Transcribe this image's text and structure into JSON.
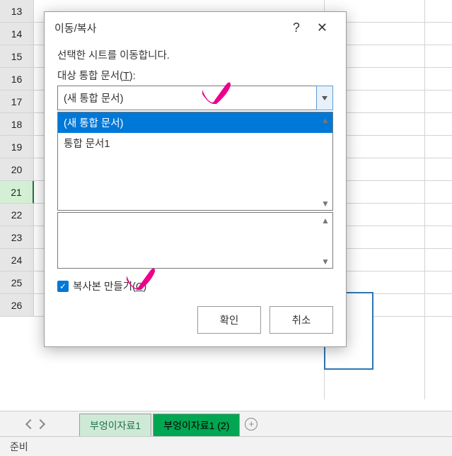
{
  "rows": [
    "13",
    "14",
    "15",
    "16",
    "17",
    "18",
    "19",
    "20",
    "21",
    "22",
    "23",
    "24",
    "25",
    "26"
  ],
  "selected_row": "21",
  "sheet_tabs": {
    "items": [
      {
        "label": "부엉이자료1",
        "variant": "light"
      },
      {
        "label": "부엉이자료1 (2)",
        "variant": "dark"
      }
    ]
  },
  "statusbar": {
    "ready": "준비"
  },
  "dialog": {
    "title": "이동/복사",
    "help_symbol": "?",
    "close_symbol": "✕",
    "instruction": "선택한 시트를 이동합니다.",
    "target_label_prefix": "대상 통합 문서(",
    "target_accel": "T",
    "target_label_suffix": "):",
    "combo_value": "(새 통합 문서)",
    "workbook_list": [
      {
        "label": "(새 통합 문서)",
        "selected": true
      },
      {
        "label": "통합 문서1",
        "selected": false
      }
    ],
    "copy_label_prefix": "복사본 만들기(",
    "copy_accel": "C",
    "copy_label_suffix": ")",
    "copy_checked": true,
    "ok": "확인",
    "cancel": "취소"
  }
}
